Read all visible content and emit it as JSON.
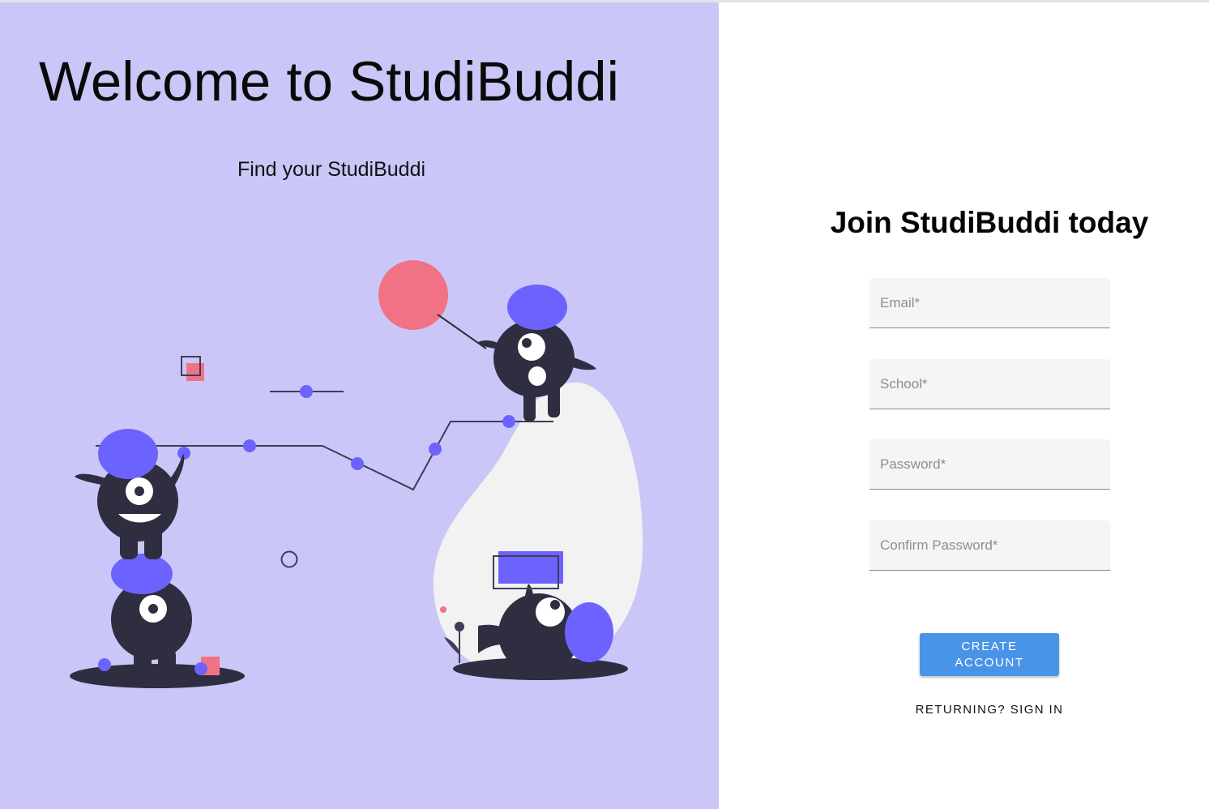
{
  "hero": {
    "title": "Welcome to StudiBuddi",
    "subtitle": "Find your StudiBuddi",
    "illustration": "monsters-climbing-graph-illustration"
  },
  "form": {
    "title": "Join StudiBuddi today",
    "email_placeholder": "Email*",
    "school_placeholder": "School*",
    "password_placeholder": "Password*",
    "confirm_password_placeholder": "Confirm Password*",
    "create_label": "CREATE ACCOUNT",
    "signin_label": "RETURNING? SIGN IN"
  },
  "colors": {
    "panel_bg": "#cac7f8",
    "accent_purple": "#6c63ff",
    "accent_pink": "#f07284",
    "character_dark": "#2f2e41",
    "button_blue": "#4a94e8"
  }
}
